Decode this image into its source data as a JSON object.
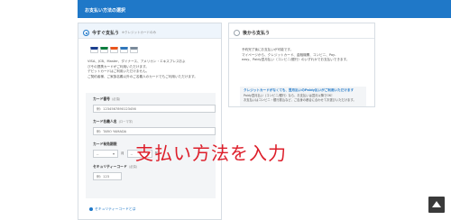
{
  "header": {
    "title": "お支払い方法の選択"
  },
  "pay_now": {
    "label": "今すぐ支払う",
    "note": "※クレジットカードのみ",
    "card_logos": [
      {
        "name": "visa-logo",
        "color": "#1a3f8f"
      },
      {
        "name": "jcb-logo",
        "color": "#0a7d3e"
      },
      {
        "name": "mastercard-logo",
        "color": "#e9551c"
      },
      {
        "name": "amex-logo",
        "color": "#2e77bb"
      },
      {
        "name": "diners-logo",
        "color": "#7a8a9a"
      }
    ],
    "description_lines": [
      "VISA、JCB、Master、ダイナース、アメリカン・エキスプレスおよ",
      "びその提携カードがご利用いただけます。",
      "デビットカードはご利用いただけません。",
      "ご契約者様、ご家族名義以外のご名義人のカードでもご利用いただけます。"
    ],
    "card_number": {
      "label": "カード番号",
      "req": "(必須)",
      "placeholder": "例：1234567890123456"
    },
    "card_holder": {
      "label": "カード名義人名",
      "req": "(ローマ字)",
      "placeholder": "例：TARO YAMADA"
    },
    "expiry": {
      "label": "カード有効期限",
      "req": "",
      "month_value": "--",
      "month_unit": "月",
      "year_value": "--",
      "year_unit": "年"
    },
    "cvv": {
      "label": "セキュリティーコード",
      "req": "(必須)",
      "placeholder": "例：123"
    },
    "cvv_link": "セキュリティーコードとは"
  },
  "pay_later": {
    "label": "後から支払う",
    "description_lines": [
      "予約完了後にお支払いが可能です。",
      "マイページから、クレジットカード、金融機関、コンビニ、Pay-",
      "easy、Paidy翌月払い（コンビニ/銀行）のいずれかでお支払いできます。"
    ],
    "notice_title": "クレジットカードがなくても、翌月払いのPaidy払いがご利用いただけます",
    "notice_lines": [
      "Paidy翌月払い（コンビニ/銀行）なら、お支払いは翌月以降でOK！",
      "お支払いはコンビニ・銀行振込など、ご自身の都合に合わせてお選びいただけます。"
    ]
  },
  "overlay": {
    "text": "支払い方法を入力",
    "color": "#dd1e2a"
  },
  "accent_color": "#1f78c8",
  "back_to_top_icon": "arrow-up-icon"
}
